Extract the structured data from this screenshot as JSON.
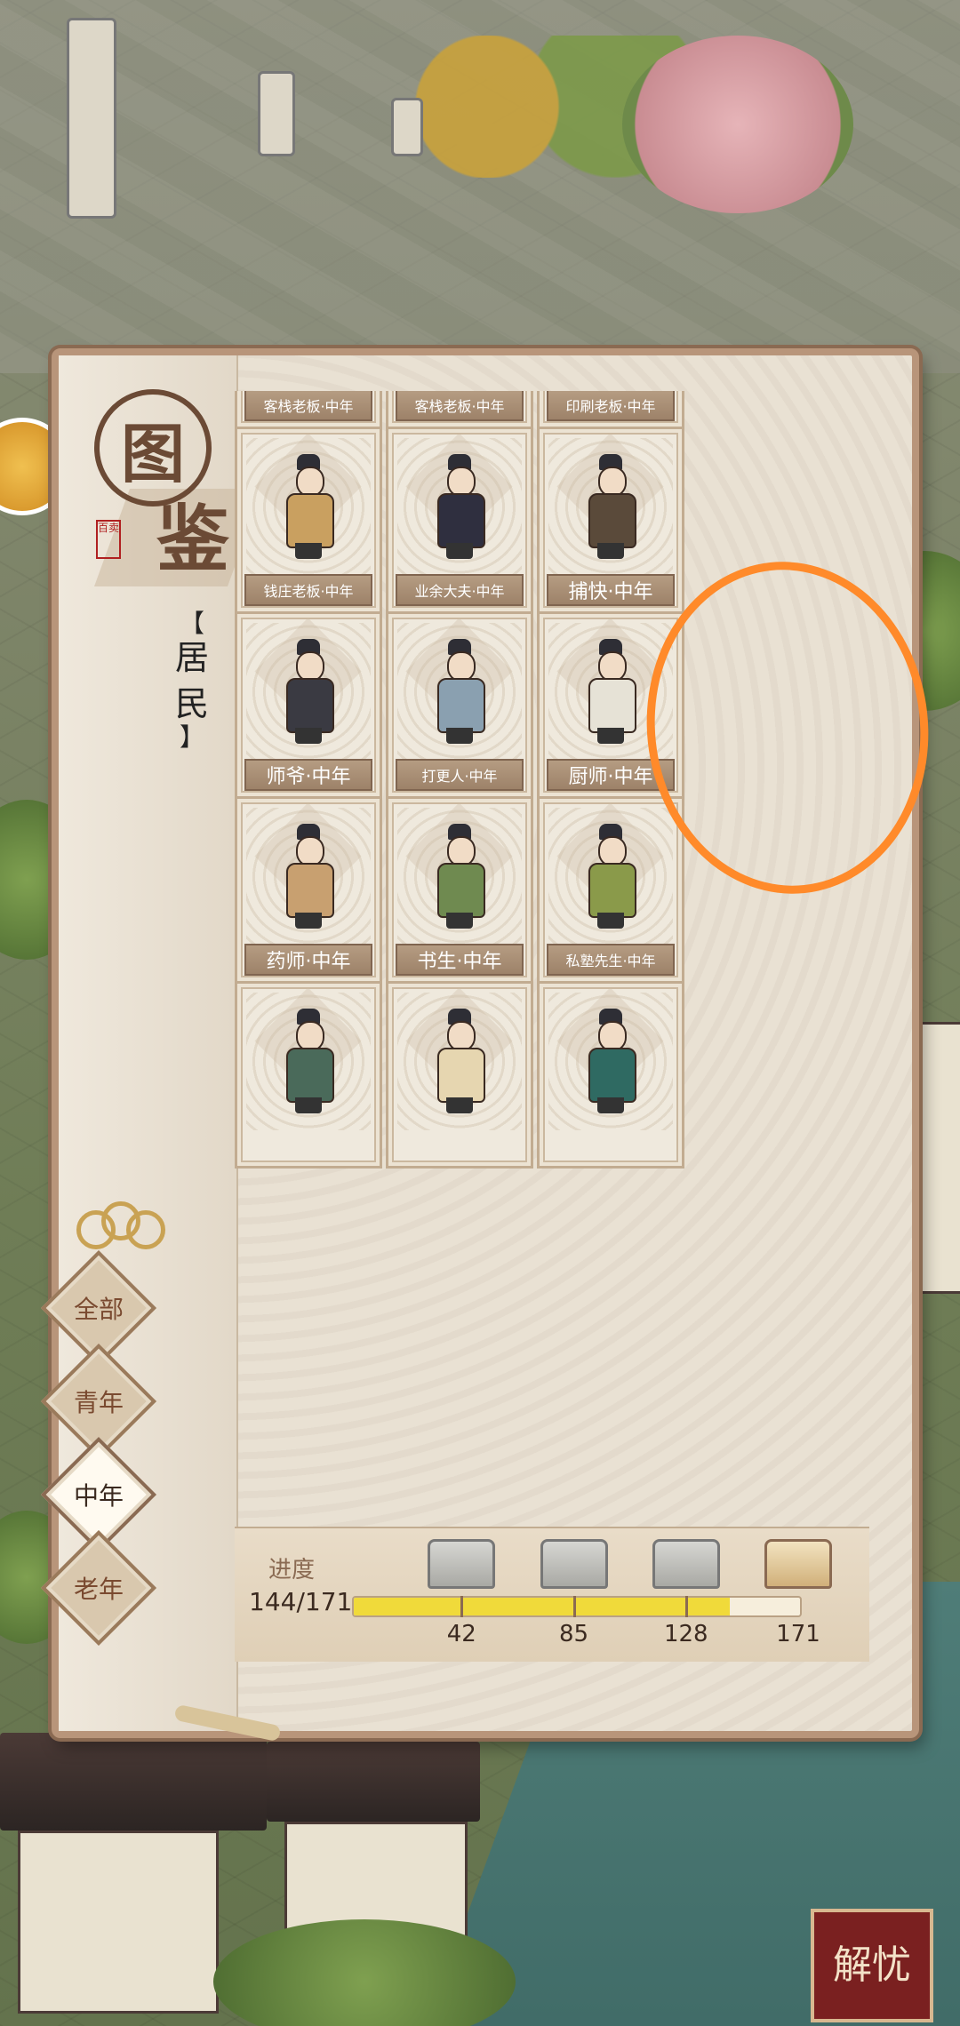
{
  "codex": {
    "title_char_1": "图",
    "title_char_2": "鉴",
    "seal_text": "百卖",
    "category_open": "【",
    "category_char_1": "居",
    "category_char_2": "民",
    "category_close": "】"
  },
  "filters": [
    {
      "label": "全部",
      "active": false
    },
    {
      "label": "青年",
      "active": false
    },
    {
      "label": "中年",
      "active": true
    },
    {
      "label": "老年",
      "active": false
    }
  ],
  "cards": [
    {
      "name": "客栈老板·中年",
      "color": "#d7d0a8"
    },
    {
      "name": "客栈老板·中年",
      "color": "#cc4a3a"
    },
    {
      "name": "印刷老板·中年",
      "color": "#9ab0c8"
    },
    {
      "name": "钱庄老板·中年",
      "color": "#c9a060"
    },
    {
      "name": "业余大夫·中年",
      "color": "#2f2f3f"
    },
    {
      "name": "捕快·中年",
      "color": "#5a4a3a"
    },
    {
      "name": "师爷·中年",
      "color": "#3a3a42"
    },
    {
      "name": "打更人·中年",
      "color": "#8aa0b0"
    },
    {
      "name": "厨师·中年",
      "color": "#e6e2d6"
    },
    {
      "name": "药师·中年",
      "color": "#c8a070"
    },
    {
      "name": "书生·中年",
      "color": "#6f8a50"
    },
    {
      "name": "私塾先生·中年",
      "color": "#8a9a4a"
    },
    {
      "name": "",
      "color": "#4a6a5a"
    },
    {
      "name": "",
      "color": "#e6d6b0"
    },
    {
      "name": "",
      "color": "#2f6a62"
    }
  ],
  "progress": {
    "label": "进度",
    "count_text": "144/171",
    "current": 144,
    "total": 171,
    "milestones": [
      "42",
      "85",
      "128",
      "171"
    ]
  },
  "corner_stamp": "解忧"
}
